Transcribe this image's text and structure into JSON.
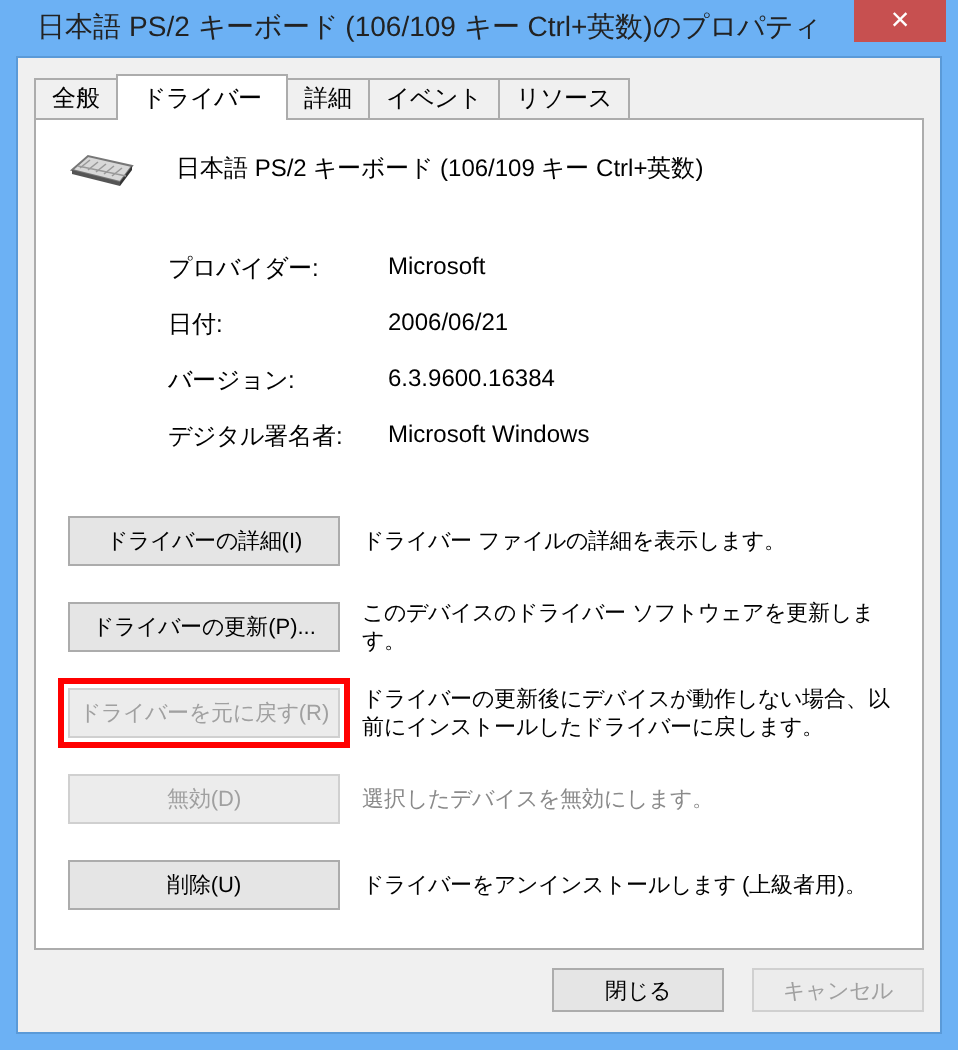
{
  "window": {
    "title": "日本語 PS/2 キーボード (106/109 キー Ctrl+英数)のプロパティ",
    "close": "×"
  },
  "tabs": [
    {
      "label": "全般",
      "selected": false
    },
    {
      "label": "ドライバー",
      "selected": true
    },
    {
      "label": "詳細",
      "selected": false
    },
    {
      "label": "イベント",
      "selected": false
    },
    {
      "label": "リソース",
      "selected": false
    }
  ],
  "device": {
    "name": "日本語 PS/2 キーボード (106/109 キー Ctrl+英数)"
  },
  "properties": [
    {
      "label": "プロバイダー:",
      "value": "Microsoft"
    },
    {
      "label": "日付:",
      "value": "2006/06/21"
    },
    {
      "label": "バージョン:",
      "value": "6.3.9600.16384"
    },
    {
      "label": "デジタル署名者:",
      "value": "Microsoft Windows"
    }
  ],
  "actions": [
    {
      "button": "ドライバーの詳細(I)",
      "description": "ドライバー ファイルの詳細を表示します。",
      "description_disabled": false,
      "disabled": false,
      "highlighted": false
    },
    {
      "button": "ドライバーの更新(P)...",
      "description": "このデバイスのドライバー ソフトウェアを更新します。",
      "description_disabled": false,
      "disabled": false,
      "highlighted": false
    },
    {
      "button": "ドライバーを元に戻す(R)",
      "description": "ドライバーの更新後にデバイスが動作しない場合、以前にインストールしたドライバーに戻します。",
      "description_disabled": false,
      "disabled": true,
      "highlighted": true
    },
    {
      "button": "無効(D)",
      "description": "選択したデバイスを無効にします。",
      "description_disabled": true,
      "disabled": true,
      "highlighted": false
    },
    {
      "button": "削除(U)",
      "description": "ドライバーをアンインストールします (上級者用)。",
      "description_disabled": false,
      "disabled": false,
      "highlighted": false
    }
  ],
  "footer_buttons": [
    {
      "label": "閉じる",
      "disabled": false
    },
    {
      "label": "キャンセル",
      "disabled": true
    }
  ]
}
